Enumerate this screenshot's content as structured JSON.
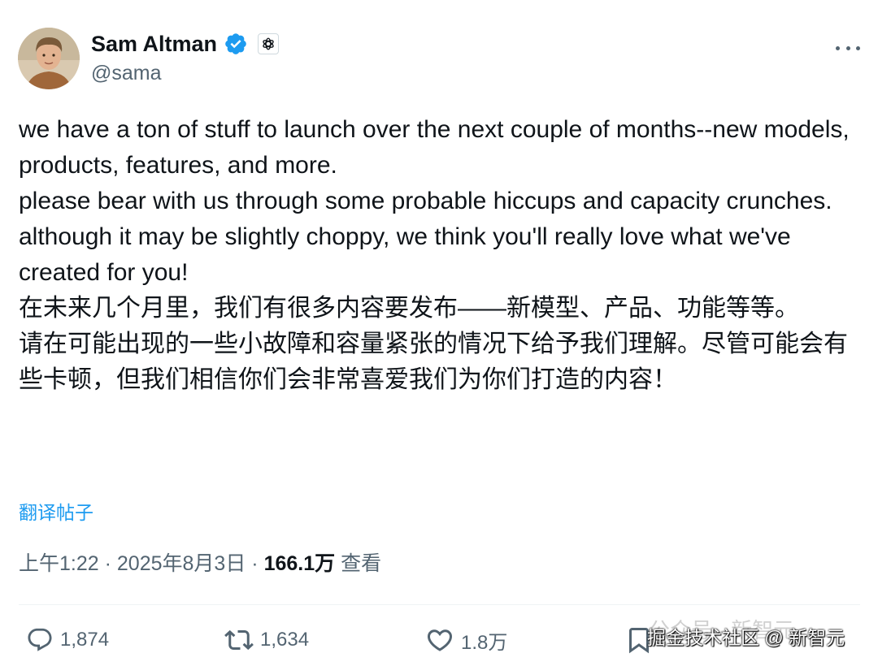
{
  "author": {
    "name": "Sam Altman",
    "handle": "@sama"
  },
  "tweet": {
    "en_paragraph_1": "we have a ton of stuff to launch over the next couple of months--new models, products, features, and more.",
    "en_paragraph_2": "please bear with us through some probable hiccups and capacity crunches. although it may be slightly choppy, we think you'll really love what we've created for you!",
    "zh_paragraph_1": "在未来几个月里，我们有很多内容要发布——新模型、产品、功能等等。",
    "zh_paragraph_2": "请在可能出现的一些小故障和容量紧张的情况下给予我们理解。尽管可能会有些卡顿，但我们相信你们会非常喜爱我们为你们打造的内容！"
  },
  "translate_link": "翻译帖子",
  "meta": {
    "time": "上午1:22",
    "separator": "·",
    "date": "2025年8月3日",
    "views_count": "166.1万",
    "views_label": "查看"
  },
  "actions": {
    "replies": "1,874",
    "retweets": "1,634",
    "likes": "1.8万"
  },
  "watermark": {
    "faint": "公众号 · 新智元",
    "main": "掘金技术社区 @ 新智元"
  },
  "icons": {
    "verified": "verified-badge-icon",
    "org": "openai-logo-icon",
    "more": "more-options-icon",
    "reply": "reply-icon",
    "retweet": "retweet-icon",
    "like": "heart-icon",
    "bookmark": "bookmark-icon"
  },
  "colors": {
    "accent": "#1d9bf0",
    "text": "#0f1419",
    "secondary": "#536471"
  }
}
